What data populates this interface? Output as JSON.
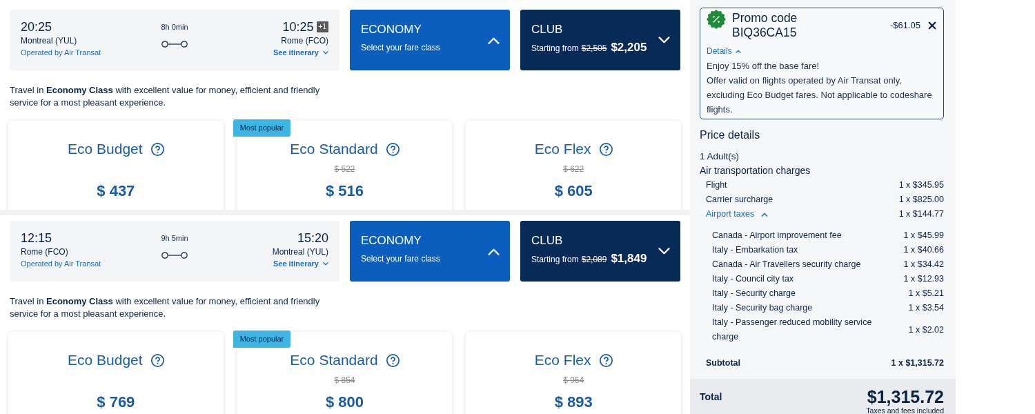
{
  "segments": [
    {
      "flight": {
        "departure_time": "20:25",
        "departure_airport": "Montreal (YUL)",
        "operator": "Operated by Air Transat",
        "duration": "8h 0min",
        "arrival_time": "10:25",
        "day_offset": "+1",
        "arrival_airport": "Rome (FCO)",
        "itinerary_link": "See itinerary"
      },
      "cabins": [
        {
          "kind": "prompt",
          "name": "ECONOMY",
          "subtitle": "Select your fare class",
          "color": "#0b5ebd",
          "expanded": true
        },
        {
          "kind": "price",
          "name": "CLUB",
          "prefix": "Starting from",
          "old_price": "$2,505",
          "price": "$2,205",
          "color": "#072a57",
          "expanded": false
        }
      ],
      "description": "Travel in **Economy Class** with excellent value for money, efficient and friendly service for a most pleasant experience.",
      "fares": [
        {
          "name": "Eco Budget",
          "price": "$ 437"
        },
        {
          "name": "Eco Standard",
          "badge": "Most popular",
          "old_price": "$ 522",
          "price": "$ 516"
        },
        {
          "name": "Eco Flex",
          "old_price": "$ 622",
          "price": "$ 605"
        }
      ]
    },
    {
      "flight": {
        "departure_time": "12:15",
        "departure_airport": "Rome (FCO)",
        "operator": "Operated by Air Transat",
        "duration": "9h 5min",
        "arrival_time": "15:20",
        "arrival_airport": "Montreal (YUL)",
        "itinerary_link": "See itinerary"
      },
      "cabins": [
        {
          "kind": "prompt",
          "name": "ECONOMY",
          "subtitle": "Select your fare class",
          "color": "#0b5ebd",
          "expanded": true
        },
        {
          "kind": "price",
          "name": "CLUB",
          "prefix": "Starting from",
          "old_price": "$2,089",
          "price": "$1,849",
          "color": "#072a57",
          "expanded": false
        }
      ],
      "description": "Travel in **Economy Class** with excellent value for money, efficient and friendly service for a most pleasant experience.",
      "fares": [
        {
          "name": "Eco Budget",
          "price": "$ 769"
        },
        {
          "name": "Eco Standard",
          "badge": "Most popular",
          "old_price": "$ 854",
          "price": "$ 800"
        },
        {
          "name": "Eco Flex",
          "old_price": "$ 964",
          "price": "$ 893"
        }
      ]
    }
  ],
  "promo": {
    "title": "Promo code",
    "code": "BIQ36CA15",
    "amount": "-$61.05",
    "details_label": "Details",
    "details_expanded": true,
    "details": [
      "Enjoy 15% off the base fare!",
      "Offer valid on flights operated by Air Transat only, excluding Eco Budget fares. Not applicable to codeshare flights."
    ]
  },
  "price_details": {
    "title": "Price details",
    "passengers": "1 Adult(s)",
    "section": "Air transportation charges",
    "items": [
      {
        "kind": "charge",
        "label": "Flight",
        "amount": "1 x $345.95"
      },
      {
        "kind": "charge",
        "label": "Carrier surcharge",
        "amount": "1 x $825.00"
      },
      {
        "kind": "group",
        "label": "Airport taxes",
        "amount": "1 x $144.77",
        "expanded": true,
        "children": [
          {
            "label": "Canada - Airport improvement fee",
            "amount": "1 x $45.99"
          },
          {
            "label": "Italy - Embarkation tax",
            "amount": "1 x $40.66"
          },
          {
            "label": "Canada - Air Travellers security charge",
            "amount": "1 x $34.42"
          },
          {
            "label": "Italy - Council city tax",
            "amount": "1 x $12.93"
          },
          {
            "label": "Italy - Security charge",
            "amount": "1 x $5.21"
          },
          {
            "label": "Italy - Security bag charge",
            "amount": "1 x $3.54"
          },
          {
            "label": "Italy - Passenger reduced mobility service charge",
            "amount": "1 x $2.02"
          }
        ]
      }
    ],
    "subtotal_label": "Subtotal",
    "subtotal": "1 x $1,315.72"
  },
  "total": {
    "label": "Total",
    "amount": "$1,315.72",
    "note": "Taxes and fees included"
  }
}
